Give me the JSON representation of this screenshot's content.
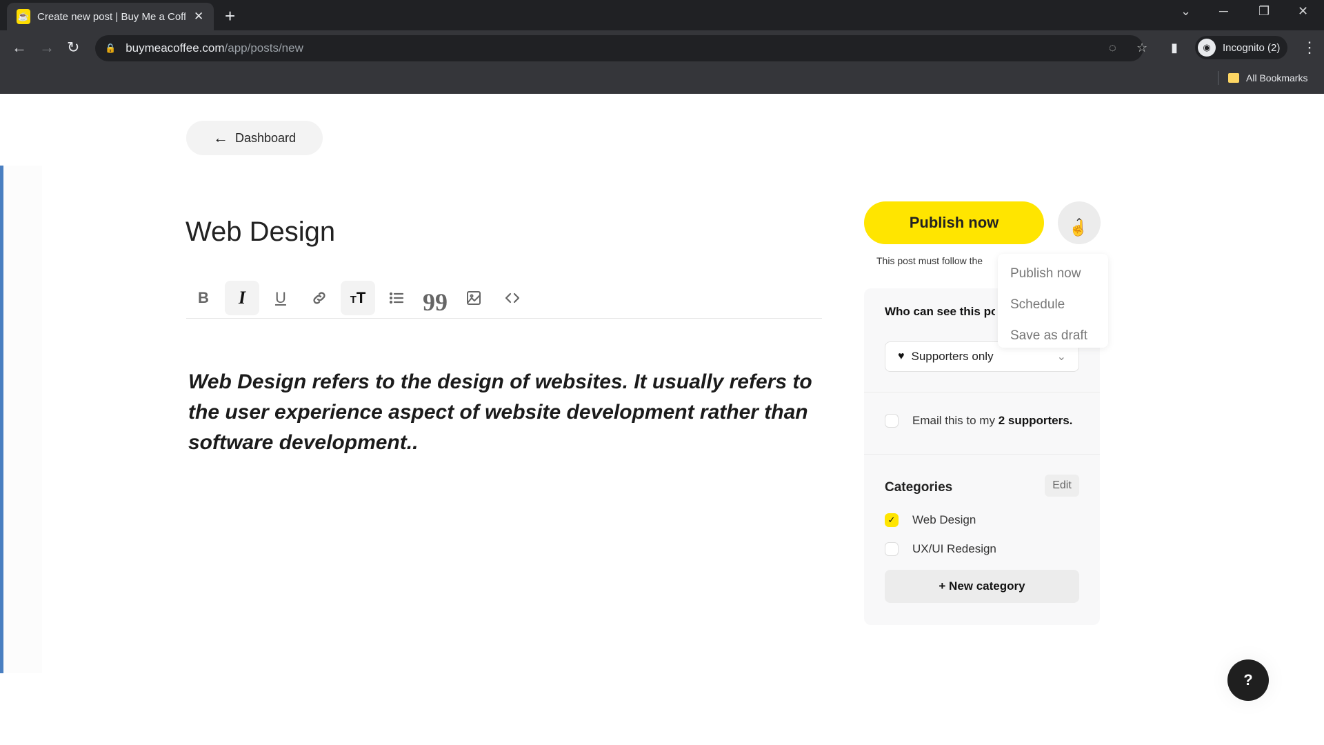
{
  "browser": {
    "tab_title": "Create new post | Buy Me a Coffee",
    "tab_title_visible": "Create new post | Buy Me a Coff",
    "url_host": "buymeacoffee.com",
    "url_path": "/app/posts/new",
    "profile_label": "Incognito (2)",
    "bookmarks_label": "All Bookmarks"
  },
  "nav": {
    "back_label": "Dashboard"
  },
  "editor": {
    "title": "Web Design",
    "toolbar": [
      "bold",
      "italic",
      "underline",
      "link",
      "text-size",
      "bulleted-list",
      "quote",
      "image",
      "code"
    ],
    "active_tools": [
      "italic",
      "text-size"
    ],
    "body": "Web Design refers to the design of websites. It usually refers to the user experience aspect of website development rather than software development.."
  },
  "publish": {
    "button_label": "Publish now",
    "note": "This post must follow the",
    "menu": [
      "Publish now",
      "Schedule",
      "Save as draft"
    ]
  },
  "settings": {
    "visibility_label": "Who can see this post?",
    "visibility_value": "Supporters only",
    "email_prefix": "Email this to my ",
    "email_count": "2 supporters.",
    "email_checked": false,
    "categories_title": "Categories",
    "edit_label": "Edit",
    "categories": [
      {
        "label": "Web Design",
        "checked": true
      },
      {
        "label": "UX/UI Redesign",
        "checked": false
      }
    ],
    "new_category_label": "+ New category"
  },
  "help": {
    "label": "?"
  },
  "colors": {
    "brand_yellow": "#ffe500",
    "accent_blue": "#4a7fc1"
  }
}
